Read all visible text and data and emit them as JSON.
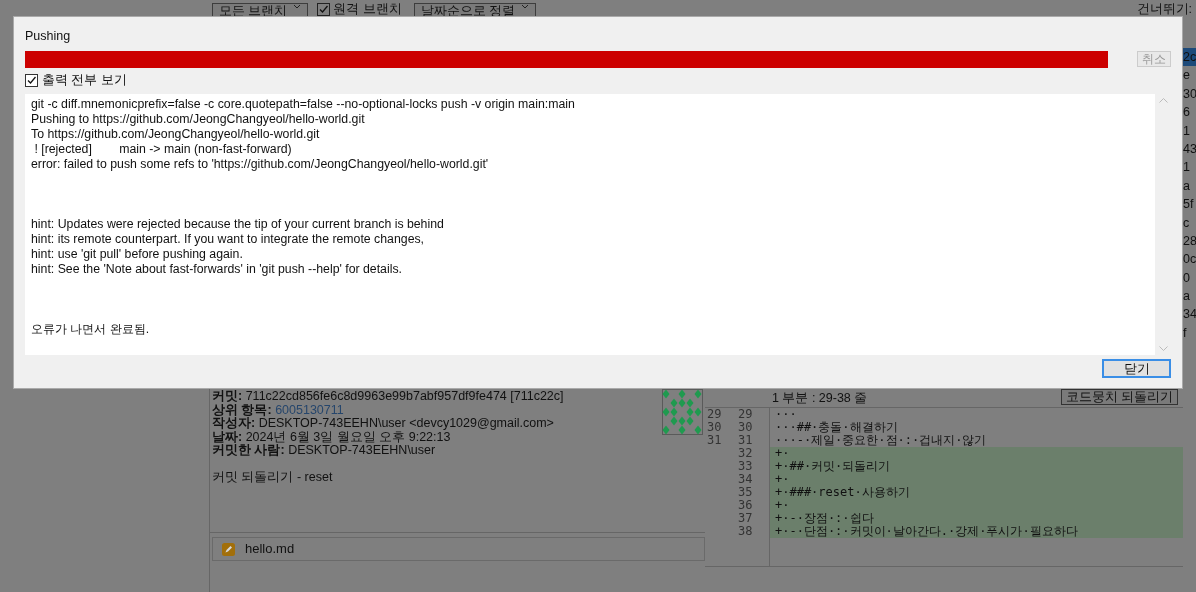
{
  "background": {
    "toolbar": {
      "branch_filter": "모든 브랜치",
      "remote_branches": {
        "label": "원격 브랜치",
        "checked": true
      },
      "sort": "날짜순으로 정렬",
      "skip_label": "건너뛰기:"
    },
    "commit_list_column": [
      {
        "text": "2c",
        "selected": true
      },
      {
        "text": "e",
        "selected": false
      },
      {
        "text": "30",
        "selected": false
      },
      {
        "text": "6",
        "selected": false
      },
      {
        "text": "1",
        "selected": false
      },
      {
        "text": "43",
        "selected": false
      },
      {
        "text": "1",
        "selected": false
      },
      {
        "text": "a",
        "selected": false
      },
      {
        "text": "5f",
        "selected": false
      },
      {
        "text": "c",
        "selected": false
      },
      {
        "text": "28",
        "selected": false
      },
      {
        "text": "0c",
        "selected": false
      },
      {
        "text": "0",
        "selected": false
      },
      {
        "text": "a",
        "selected": false
      },
      {
        "text": "34",
        "selected": false
      },
      {
        "text": "f",
        "selected": false
      }
    ],
    "commit_details": {
      "fields": [
        {
          "label": "커밋:",
          "value": "711c22cd856fe6c8d9963e99b7abf957df9fe474 [711c22c]",
          "kind": "text"
        },
        {
          "label": "상위 항목:",
          "value": "6005130711",
          "kind": "link"
        },
        {
          "label": "작성자:",
          "value": "DESKTOP-743EEHN\\user <devcy1029@gmail.com>",
          "kind": "text"
        },
        {
          "label": "날짜:",
          "value": "2024년 6월 3일 월요일 오후 9:22:13",
          "kind": "text"
        },
        {
          "label": "커밋한 사람:",
          "value": "DESKTOP-743EEHN\\user",
          "kind": "text"
        }
      ],
      "message": "커밋 되돌리기 - reset"
    },
    "files": [
      {
        "name": "hello.md",
        "kind": "modified"
      }
    ],
    "diff": {
      "hunk_title": "1 부분 : 29-38 줄",
      "revert_button": "코드뭉치 되돌리기",
      "lines": [
        {
          "old": "29",
          "new": "29",
          "text": "···",
          "kind": "context"
        },
        {
          "old": "30",
          "new": "30",
          "text": "···##·충돌·해결하기",
          "kind": "context"
        },
        {
          "old": "31",
          "new": "31",
          "text": "···-·제일·중요한·점·:·겁내지·않기",
          "kind": "context"
        },
        {
          "new": "32",
          "text": "+·",
          "kind": "added"
        },
        {
          "new": "33",
          "text": "+·##·커밋·되돌리기",
          "kind": "added"
        },
        {
          "new": "34",
          "text": "+·",
          "kind": "added"
        },
        {
          "new": "35",
          "text": "+·###·reset·사용하기",
          "kind": "added"
        },
        {
          "new": "36",
          "text": "+·",
          "kind": "added"
        },
        {
          "new": "37",
          "text": "+·-·장점·:·쉽다",
          "kind": "added"
        },
        {
          "new": "38",
          "text": "+·-·단점·:·커밋이·날아간다.·강제·푸시가·필요하다",
          "kind": "added"
        }
      ]
    }
  },
  "dialog": {
    "title": "Pushing",
    "progress": {
      "level": 1.0
    },
    "cancel_button": {
      "label": "취소",
      "disabled": true
    },
    "show_all_output": {
      "label": "출력 전부 보기",
      "checked": true
    },
    "output_blocks": [
      [
        "git -c diff.mnemonicprefix=false -c core.quotepath=false --no-optional-locks push -v origin main:main",
        "Pushing to https://github.com/JeongChangyeol/hello-world.git",
        "To https://github.com/JeongChangyeol/hello-world.git",
        " ! [rejected]        main -> main (non-fast-forward)",
        "error: failed to push some refs to 'https://github.com/JeongChangyeol/hello-world.git'"
      ],
      [
        "hint: Updates were rejected because the tip of your current branch is behind",
        "hint: its remote counterpart. If you want to integrate the remote changes,",
        "hint: use 'git pull' before pushing again.",
        "hint: See the 'Note about fast-forwards' in 'git push --help' for details."
      ],
      [
        "오류가 나면서 완료됨."
      ]
    ],
    "close_button": {
      "label": "닫기",
      "focused": true
    }
  }
}
